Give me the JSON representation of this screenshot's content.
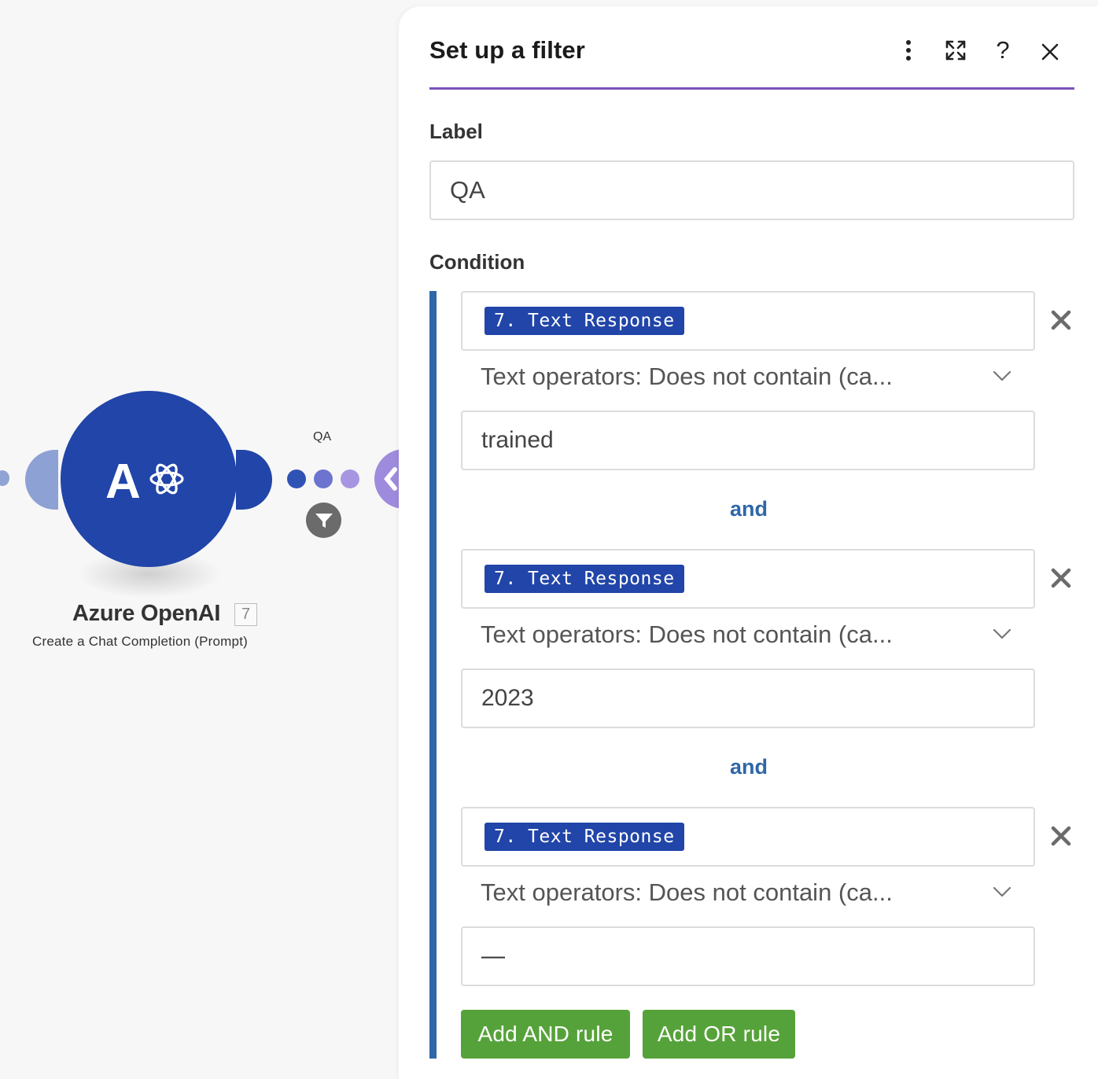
{
  "canvas": {
    "module": {
      "title": "Azure OpenAI",
      "badge": "7",
      "subtitle": "Create a Chat Completion (Prompt)",
      "icon": "azure-openai-logo",
      "logo_letter": "A",
      "color": "#2145a8"
    },
    "link": {
      "label": "QA",
      "filter_icon": "filter-funnel-icon"
    }
  },
  "panel": {
    "title": "Set up a filter",
    "header_icons": [
      "more-vertical-icon",
      "maximize-icon",
      "help-icon",
      "close-icon"
    ],
    "help_glyph": "?",
    "label_section": {
      "label": "Label",
      "value": "QA"
    },
    "condition_section": {
      "label": "Condition",
      "rules": [
        {
          "field": "7. Text Response",
          "operator": "Text operators: Does not contain (ca...",
          "value": "trained"
        },
        {
          "field": "7. Text Response",
          "operator": "Text operators: Does not contain (ca...",
          "value": "2023"
        },
        {
          "field": "7. Text Response",
          "operator": "Text operators: Does not contain (ca...",
          "value": "—"
        }
      ],
      "joiner": "and"
    },
    "buttons": {
      "add_and": "Add AND rule",
      "add_or": "Add OR rule"
    },
    "colors": {
      "accent": "#7b52b9",
      "condition_bar": "#2f67a8",
      "pill": "#2145a8",
      "green_button": "#56a23a"
    }
  }
}
